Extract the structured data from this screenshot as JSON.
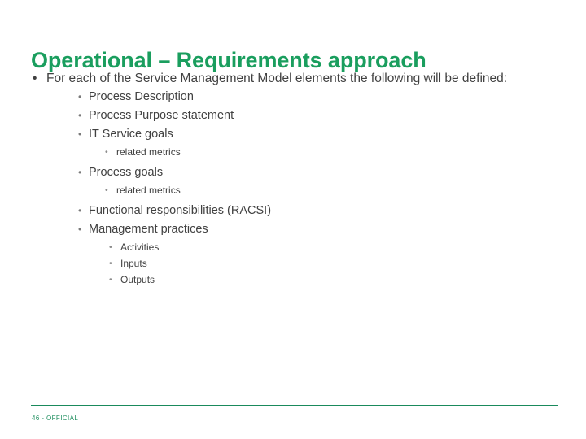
{
  "slide": {
    "title": "Operational – Requirements approach",
    "bullet_glyph": "•",
    "colors": {
      "title_green": "#1a9e5e",
      "body_gray": "#414141",
      "muted_gray": "#5d5d5d",
      "footer_green": "#1f8f5f",
      "rule_green": "#1a8a5c",
      "background": "#ffffff"
    },
    "level1": {
      "text": "For each of the Service Management Model elements the following will be defined:"
    },
    "level2_group_a": [
      {
        "text": "Process Description"
      },
      {
        "text": "Process Purpose statement"
      },
      {
        "text": "IT Service goals"
      }
    ],
    "level3_after_it_service_goals": [
      {
        "text": "related metrics"
      }
    ],
    "level2_process_goals": {
      "text": "Process goals"
    },
    "level3_after_process_goals": [
      {
        "text": "related metrics"
      }
    ],
    "level2_group_b": [
      {
        "text": "Functional responsibilities (RACSI)"
      },
      {
        "text": "Management practices"
      }
    ],
    "level3_after_management_practices": [
      {
        "text": "Activities"
      },
      {
        "text": "Inputs"
      },
      {
        "text": "Outputs"
      }
    ],
    "footer": {
      "text": "46 - OFFICIAL"
    }
  }
}
